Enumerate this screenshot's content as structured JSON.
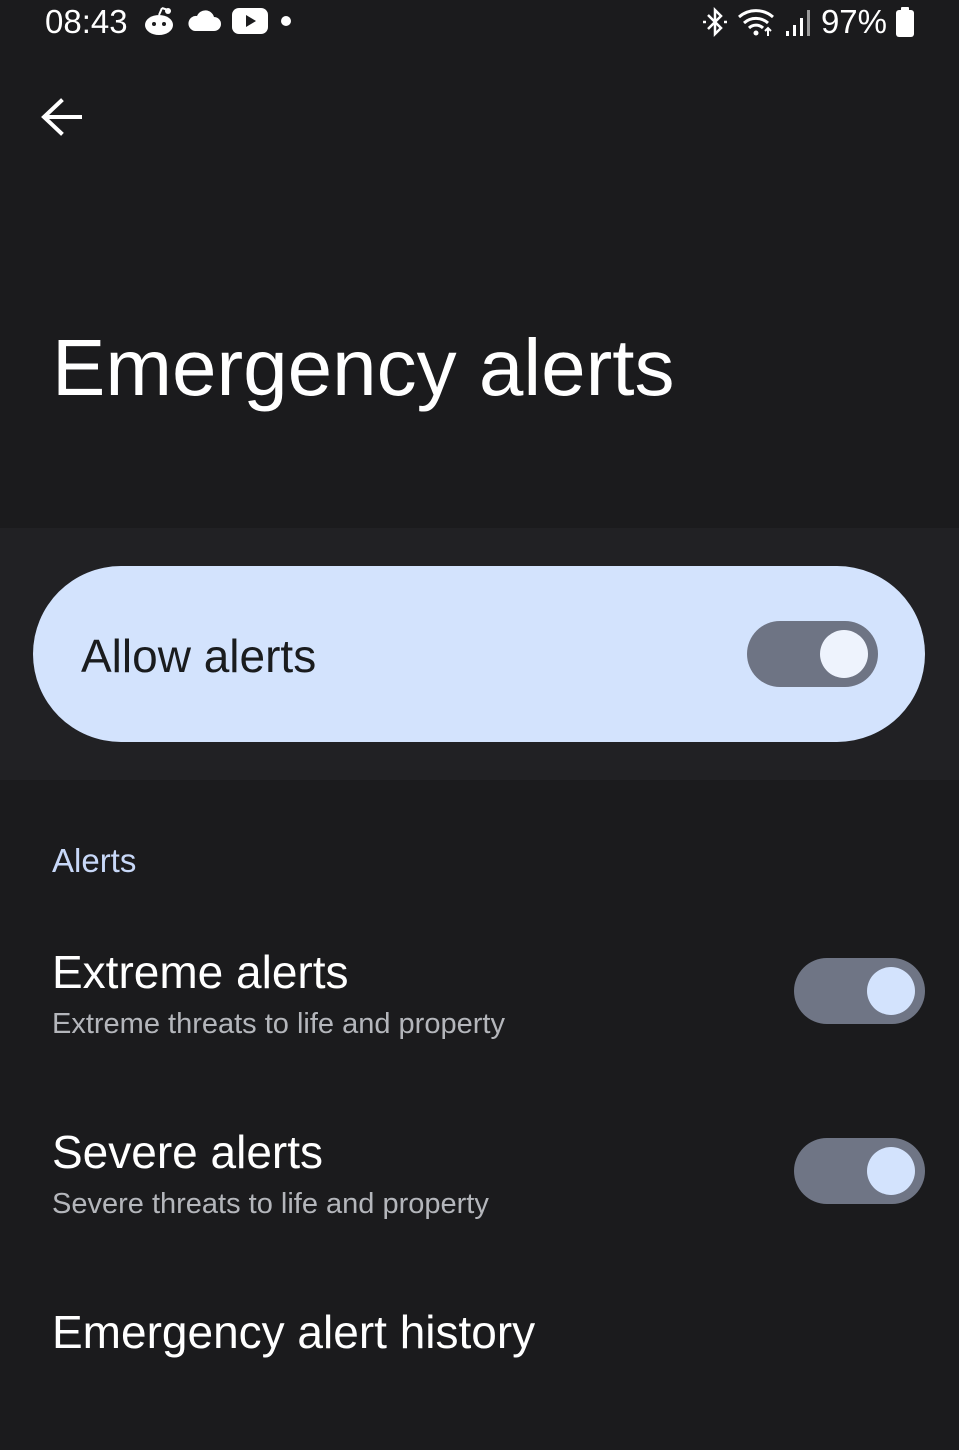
{
  "status_bar": {
    "time": "08:43",
    "battery_percent": "97%",
    "left_icons": [
      "reddit-icon",
      "cloud-icon",
      "youtube-icon",
      "notification-dot-icon"
    ],
    "right_icons": [
      "bluetooth-icon",
      "wifi-icon",
      "signal-icon",
      "battery-icon"
    ]
  },
  "toolbar": {
    "back_icon": "arrow-back-icon"
  },
  "page": {
    "title": "Emergency alerts"
  },
  "main_switch": {
    "label": "Allow alerts",
    "checked": true
  },
  "sections": [
    {
      "header": "Alerts",
      "items": [
        {
          "title": "Extreme alerts",
          "summary": "Extreme threats to life and property",
          "checked": true
        },
        {
          "title": "Severe alerts",
          "summary": "Severe threats to life and property",
          "checked": true
        },
        {
          "title": "Emergency alert history"
        }
      ]
    }
  ],
  "colors": {
    "background": "#1b1b1d",
    "main_switch_bg": "#d3e3fd",
    "toggle_track": "#6f7585",
    "toggle_thumb": "#d3e3fd",
    "section_header": "#c8d8f8"
  }
}
